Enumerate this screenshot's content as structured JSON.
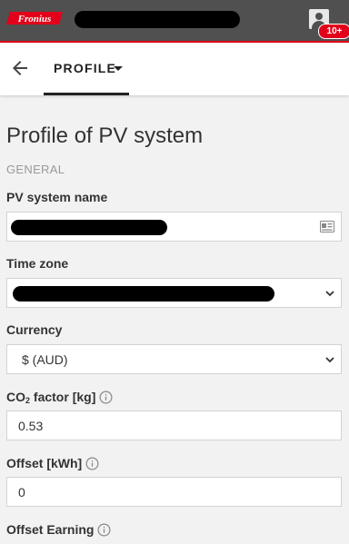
{
  "header": {
    "brand": "Fronius",
    "notification_badge": "10+",
    "brand_color": "#e2001a",
    "user_icon": "account-icon"
  },
  "nav": {
    "back_icon": "arrow-left-icon",
    "tab_label": "PROFILE"
  },
  "page": {
    "title": "Profile of PV system",
    "section": "GENERAL"
  },
  "fields": {
    "pv_system_name": {
      "label": "PV system name"
    },
    "time_zone": {
      "label": "Time zone"
    },
    "currency": {
      "label": "Currency",
      "value": "$ (AUD)"
    },
    "co2_factor": {
      "label_prefix": "CO",
      "label_sub": "2",
      "label_suffix": " factor [kg]",
      "value": "0.53"
    },
    "offset_kwh": {
      "label": "Offset [kWh]",
      "value": "0"
    },
    "offset_earning": {
      "label": "Offset Earning"
    }
  }
}
